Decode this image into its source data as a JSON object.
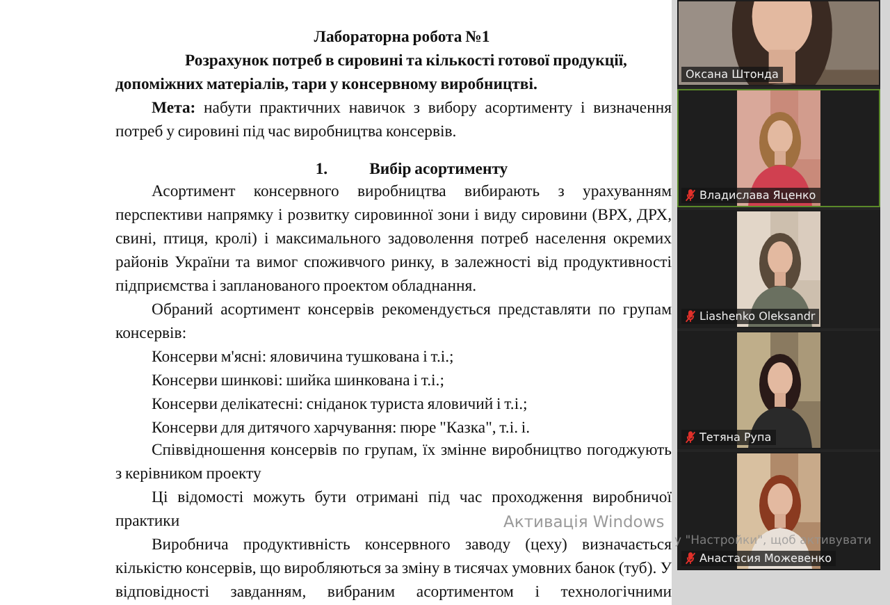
{
  "document": {
    "title_lines": [
      "Лабораторна робота №1",
      "Розрахунок потреб в сировині та кількості готової продукції,",
      "допоміжних матеріалів, тари у консервному виробництві."
    ],
    "goal_lines": [
      "**Мета:** набути практичних навичок з вибору асортименту і визначення",
      "потреб у сировині під час виробництва консервів."
    ],
    "section_heading": {
      "number": "1.",
      "title": "Вибір асортименту"
    },
    "blocks": [
      {
        "kind": "paragraph",
        "lines": [
          "Асортимент консервного виробництва вибирають з урахуванням",
          "перспективи напрямку і розвитку сировинної зони і виду сировини (ВРХ, ДРХ,",
          "свині, птиця, кролі) і максимального задоволення потреб населення окремих",
          "районів України та вимог споживчого ринку, в залежності від продуктивності",
          "підприємства і запланованого проектом обладнання."
        ]
      },
      {
        "kind": "paragraph",
        "lines": [
          "Обраний асортимент консервів рекомендується представляти по групам",
          "консервів:"
        ]
      },
      {
        "kind": "item",
        "lines": [
          "Консерви м'ясні: яловичина тушкована і т.і.;"
        ]
      },
      {
        "kind": "item",
        "lines": [
          "Консерви шинкові: шийка шинкована і т.і.;"
        ]
      },
      {
        "kind": "item",
        "lines": [
          "Консерви делікатесні: сніданок туриста яловичий і т.і.;"
        ]
      },
      {
        "kind": "item",
        "lines": [
          "Консерви для дитячого харчування: пюре \"Казка\", т.і. і."
        ]
      },
      {
        "kind": "paragraph",
        "lines": [
          "Співвідношення консервів по групам, їх змінне виробництво погоджують",
          "з керівником проекту"
        ]
      },
      {
        "kind": "paragraph",
        "lines": [
          "Ці відомості можуть бути отримані під час проходження виробничої",
          "практики"
        ]
      },
      {
        "kind": "paragraph",
        "continues": true,
        "lines": [
          "Виробнича продуктивність консервного заводу (цеху) визначається",
          "кількістю консервів, що виробляються за зміну в тисячах умовних банок (туб). У",
          "відповідності завданням, вибраним асортиментом і технологічними"
        ]
      }
    ]
  },
  "participants": [
    {
      "name": "Оксана Штонда",
      "muted": false,
      "speaking": false
    },
    {
      "name": "Владислава Яценко",
      "muted": true,
      "speaking": true
    },
    {
      "name": "Liashenko Oleksandr",
      "muted": true,
      "speaking": false
    },
    {
      "name": "Тетяна Рупа",
      "muted": true,
      "speaking": false
    },
    {
      "name": "Анастасия Можевенко",
      "muted": true,
      "speaking": false
    }
  ],
  "activation_notice": {
    "title": "Активація Windows",
    "hint": "у \"Настройки\", щоб активувати"
  }
}
